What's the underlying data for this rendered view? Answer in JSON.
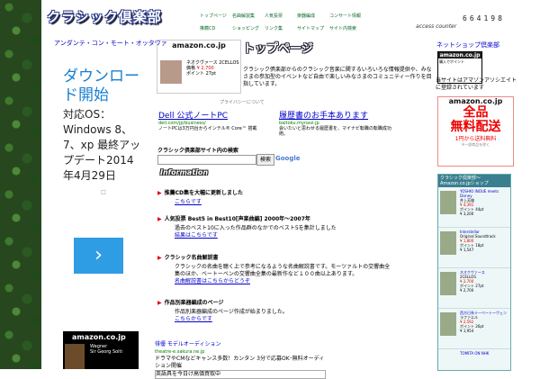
{
  "header": {
    "site_name": "クラシック倶楽部",
    "nav_row1": [
      "トップページ",
      "名曲解説集",
      "人気投票",
      "楽器編成",
      "コンサート情報"
    ],
    "nav_row2": [
      "推薦CD",
      "ショッピング",
      "リンク集",
      "サイトマップ",
      "サイト内検索"
    ],
    "counter_label": "access counter",
    "counter_value": "664198"
  },
  "topline": {
    "link": "アンダンテ・コン・モート・オッタヴァ"
  },
  "left_ad": {
    "headline": "ダウンロード開始",
    "body": "対応OS：Windows 8、7、xp 最終アップデート2014年4月29日",
    "arrow": "›"
  },
  "left_amazon": {
    "logo": "amazon.co.jp",
    "title": "Wagner",
    "artist": "Sir Georg Solti"
  },
  "main_amazon": {
    "logo": "amazon.co.jp",
    "title": "ネオクヴァース 2CELLOS",
    "label": "価格",
    "price": "¥ 2,700",
    "points": "ポイント 27pt"
  },
  "page_title": "トップページ",
  "intro": "クラシック倶楽部からのクラシック音楽に関するいろいろな情報提供や、みなさまの参加型のイベントなど自由で楽しいみなさまのコミュニティー作りを目指しています。",
  "privacy": "プライバシーについて",
  "ads": [
    {
      "title": "Dell 公式ノートPC",
      "url": "dell.com/jp/business/",
      "desc": "ノートPCは3万円台からインテル® Core™ 搭載"
    },
    {
      "title": "履歴書のお手本あります",
      "url": "baitoku.mynavi.jp",
      "desc": "会いたいと思わせる履歴書を、マイナビ転職の転職成功術。"
    }
  ],
  "search": {
    "label": "クラシック倶楽部サイト内の検索",
    "button": "検索",
    "provider": "Google"
  },
  "info_label": "Information",
  "news": [
    {
      "title": "推薦CD集を大幅に更新しました",
      "body": "",
      "link": "こちらです"
    },
    {
      "title": "人気投票 Best5 in Best10[声楽曲編] 2000年〜2007年",
      "body": "過去のベスト10に入った作品群のなかでのベスト5を集計しました",
      "link": "結果はこちらです"
    },
    {
      "title": "クラシック名曲解説書",
      "body": "クラシックの名曲を聴く上で参考になるような名曲解説書です。モーツァルトの交響曲全集のほか、ベートーベンの交響曲全集の最新作など１００曲以上あります。",
      "link": "名曲解説書はこちらからどうぞ"
    },
    {
      "title": "作品別楽器編成のページ",
      "body": "作品別楽器編成のページ作成が始まりました。",
      "link": "こちらからです"
    }
  ],
  "audition": {
    "title": "俳優 モデルオーディション",
    "url": "theatre-e.sakura.ne.jp",
    "desc": "ドラマやCMなどキャンス多数！カンタン 3分で応募OK･無料オーディション開催",
    "footer": "英語具を今日け高価買取中"
  },
  "right": {
    "net_shop": "ネットショップ倶楽部",
    "amazon_small_logo": "amazon.co.jp",
    "amazon_small_text": "購入でポイント",
    "associate_text": "当サイトはアマゾンアソシエイトに登録されています",
    "free_shipping": {
      "logo": "amazon.co.jp",
      "headline1": "全品",
      "headline2": "無料配送",
      "sub": "1円から送料無料",
      "note": "※一部商品を除く"
    },
    "shop_header": "クラシック倶楽部〜Amazon.co.jpショップ",
    "shop_items": [
      {
        "title": "YOSHIO INOUE meets Disney",
        "artist": "井上芳雄",
        "price": "¥ 4,391",
        "points": "ポイント 44pt",
        "extra": "¥ 3,200"
      },
      {
        "title": "Interstellar",
        "artist": "Original Soundtrack",
        "price": "¥ 1,800",
        "points": "ポイント 18pt",
        "extra": "¥ 1,547"
      },
      {
        "title": "ネオクヴァース",
        "artist": "2CELLOS",
        "price": "¥ 2,700",
        "points": "ポイント 27pt",
        "extra": "¥ 2,700"
      },
      {
        "title": "西方日系十一ベートーヴェン",
        "artist": "ラファエル",
        "price": "¥ 2,592",
        "points": "ポイント 26pt",
        "extra": "¥ 1,954"
      },
      {
        "title": "TOMITA ON NHK",
        "artist": "",
        "price": "",
        "points": "",
        "extra": ""
      }
    ]
  }
}
